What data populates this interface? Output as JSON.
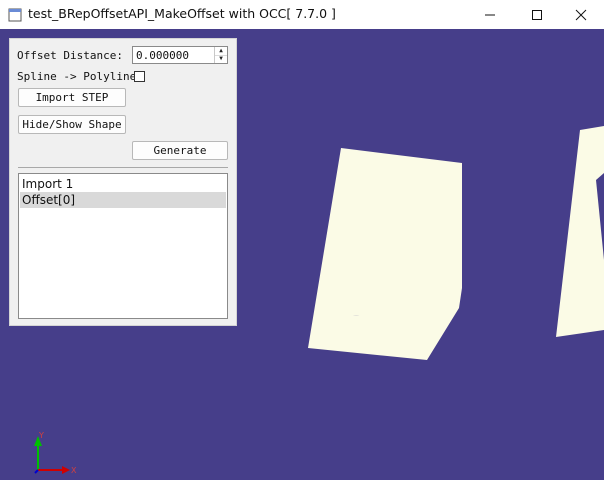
{
  "window": {
    "title": "test_BRepOffsetAPI_MakeOffset with OCC[ 7.7.0 ]",
    "controls": {
      "minimize": "minimize-icon",
      "maximize": "maximize-icon",
      "close": "close-icon"
    }
  },
  "panel": {
    "offset_label": "Offset Distance:",
    "offset_value": "0.000000",
    "spline_label": "Spline -> Polyline",
    "spline_checked": false,
    "import_button": "Import STEP",
    "hide_show_button": "Hide/Show Shape",
    "generate_button": "Generate",
    "list_items": [
      {
        "label": "Import 1",
        "selected": false
      },
      {
        "label": "Offset[0]",
        "selected": true
      }
    ]
  },
  "viewport": {
    "background": "#463e8a",
    "shape_color": "#fbfbe6",
    "axes": {
      "x": "X",
      "y": "Y"
    }
  }
}
